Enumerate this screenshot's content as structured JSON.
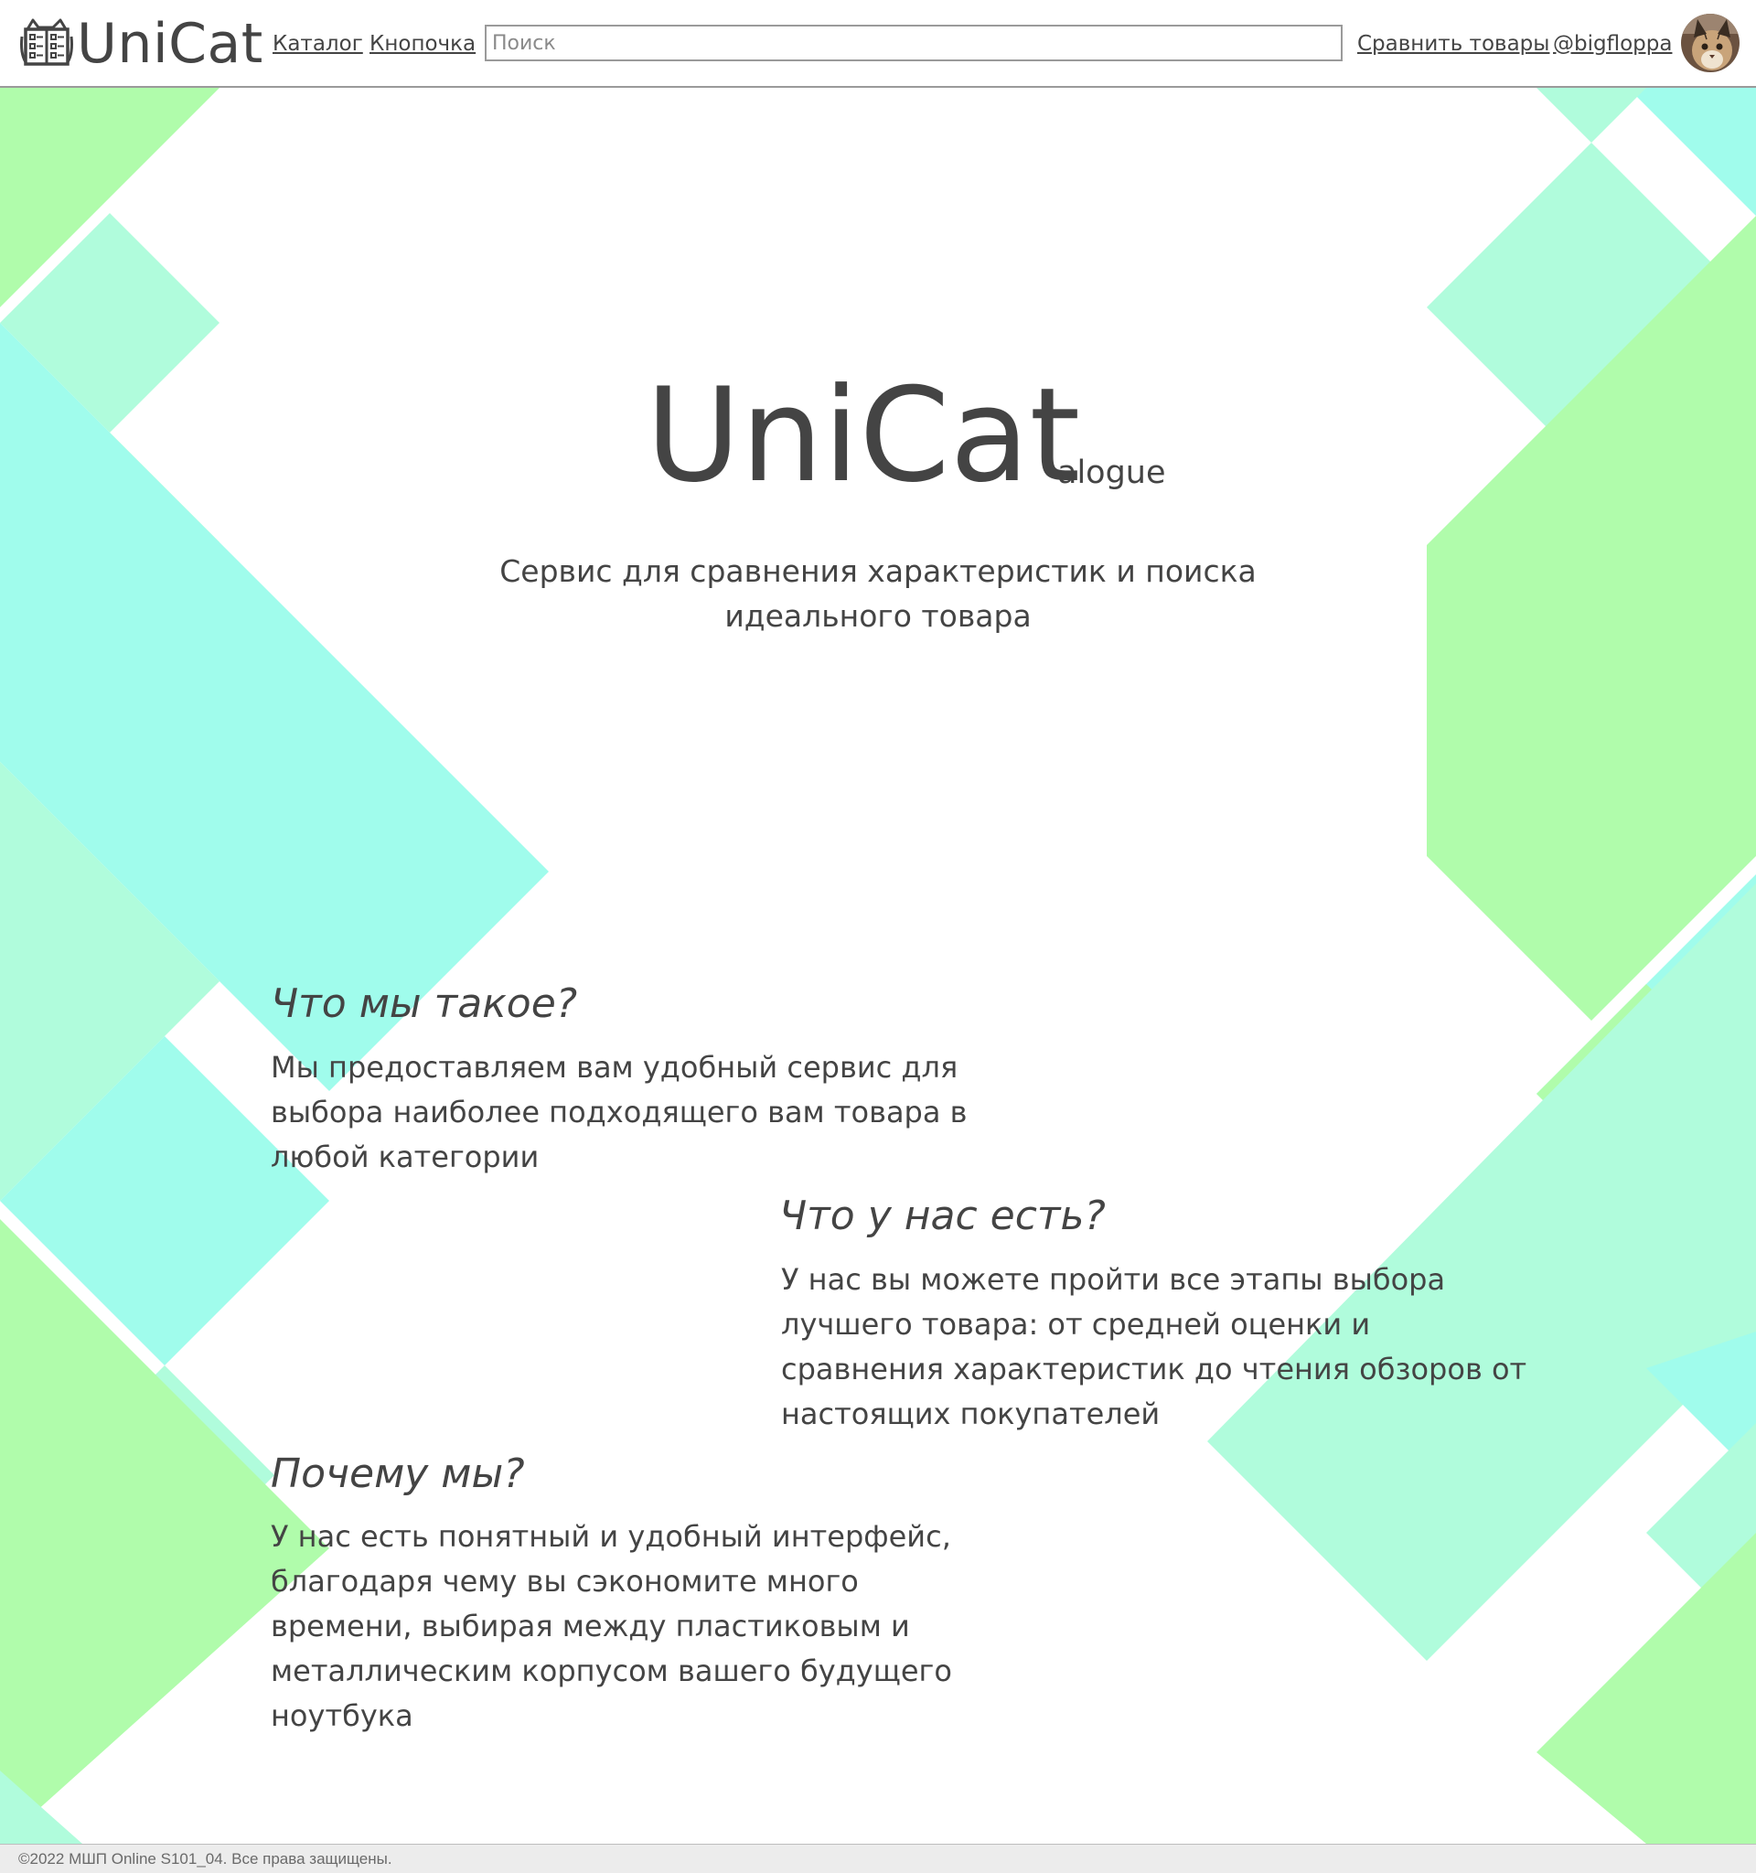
{
  "header": {
    "logo_text": "UniCat",
    "nav": {
      "catalog": "Каталог",
      "button": "Кнопочка",
      "compare": "Сравнить товары",
      "profile": "@bigfloppa"
    },
    "search_placeholder": "Поиск"
  },
  "hero": {
    "title": "UniCat",
    "title_suffix": "alogue",
    "tagline": "Сервис для сравнения характеристик и поиска идеального товара"
  },
  "sections": [
    {
      "title": "Что мы такое?",
      "text": "Мы предоставляем вам удобный сервис для выбора наиболее подходящего вам товара в любой категории"
    },
    {
      "title": "Что у нас есть?",
      "text": "У нас вы можете пройти все этапы выбора лучшего товара: от средней оценки и сравнения характеристик до чтения обзоров от настоящих покупателей"
    },
    {
      "title": "Почему мы?",
      "text": "У нас есть понятный и удобный интерфейс, благодаря чему вы сэкономите много времени, выбирая между пластиковым и металлическим корпусом вашего будущего ноутбука"
    }
  ],
  "footer": {
    "copyright": "©2022 МШП Online S101_04. Все права защищены."
  },
  "colors": {
    "text": "#444444",
    "green": "#b0fcab",
    "mint": "#b0fcdc",
    "cyan": "#a0fcec"
  },
  "icons": {
    "logo": "book-cat-icon",
    "avatar": "cat-avatar"
  }
}
